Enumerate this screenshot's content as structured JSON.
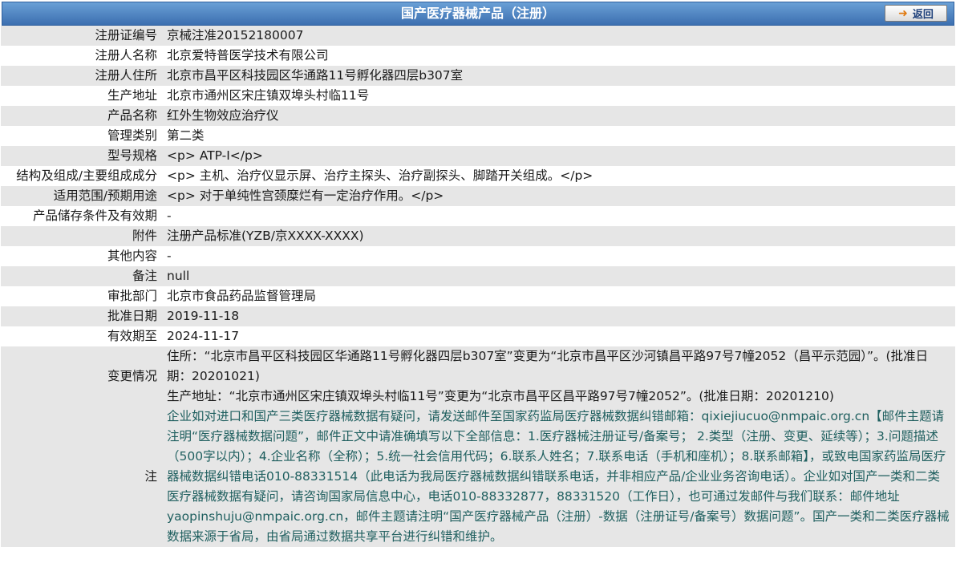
{
  "header": {
    "title": "国产医疗器械产品（注册）",
    "back_label": "返回"
  },
  "rows": [
    {
      "label": "注册证编号",
      "value": "京械注准20152180007"
    },
    {
      "label": "注册人名称",
      "value": "北京爱特普医学技术有限公司"
    },
    {
      "label": "注册人住所",
      "value": "北京市昌平区科技园区华通路11号孵化器四层b307室"
    },
    {
      "label": "生产地址",
      "value": "北京市通州区宋庄镇双埠头村临11号"
    },
    {
      "label": "产品名称",
      "value": "红外生物效应治疗仪"
    },
    {
      "label": "管理类别",
      "value": "第二类"
    },
    {
      "label": "型号规格",
      "value": "<p> ATP-I</p>"
    },
    {
      "label": "结构及组成/主要组成成分",
      "value": "<p> 主机、治疗仪显示屏、治疗主探头、治疗副探头、脚踏开关组成。</p>"
    },
    {
      "label": "适用范围/预期用途",
      "value": "<p> 对于单纯性宫颈糜烂有一定治疗作用。</p>"
    },
    {
      "label": "产品储存条件及有效期",
      "value": "-"
    },
    {
      "label": "附件",
      "value": "注册产品标准(YZB/京XXXX-XXXX)"
    },
    {
      "label": "其他内容",
      "value": "-"
    },
    {
      "label": "备注",
      "value": "null"
    },
    {
      "label": "审批部门",
      "value": "北京市食品药品监督管理局"
    },
    {
      "label": "批准日期",
      "value": "2019-11-18"
    },
    {
      "label": "有效期至",
      "value": "2024-11-17"
    },
    {
      "label": "变更情况",
      "value": "住所：“北京市昌平区科技园区华通路11号孵化器四层b307室”变更为“北京市昌平区沙河镇昌平路97号7幢2052（昌平示范园）”。(批准日期：20201021)\n生产地址：“北京市通州区宋庄镇双埠头村临11号”变更为“北京市昌平区昌平路97号7幢2052”。(批准日期：20201210)"
    },
    {
      "label": "注",
      "value": "企业如对进口和国产三类医疗器械数据有疑问，请发送邮件至国家药监局医疗器械数据纠错邮箱：qixiejiucuo@nmpaic.org.cn【邮件主题请注明“医疗器械数据问题”，邮件正文中请准确填写以下全部信息：1.医疗器械注册证号/备案号； 2.类型（注册、变更、延续等）；3.问题描述（500字以内）；4.企业名称（全称）；5.统一社会信用代码；6.联系人姓名；7.联系电话（手机和座机）；8.联系邮箱】，或致电国家药监局医疗器械数据纠错电话010-88331514（此电话为我局医疗器械数据纠错联系电话，并非相应产品/企业业务咨询电话）。企业如对国产一类和二类医疗器械数据有疑问，请咨询国家局信息中心，电话010-88332877，88331520（工作日），也可通过发邮件与我们联系：邮件地址yaopinshuju@nmpaic.org.cn，邮件主题请注明“国产医疗器械产品（注册）-数据（注册证号/备案号）数据问题”。国产一类和二类医疗器械数据来源于省局，由省局通过数据共享平台进行纠错和维护。"
    }
  ]
}
